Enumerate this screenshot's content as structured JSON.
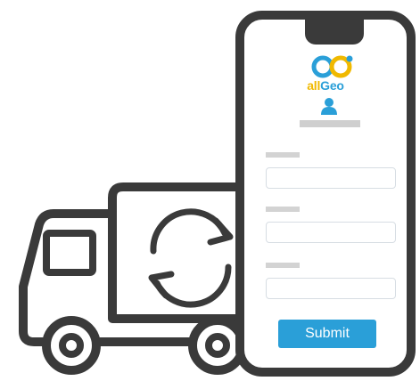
{
  "brand": {
    "logo_prefix": "all",
    "logo_suffix": "Geo",
    "primary_color": "#2a9fd8",
    "accent_color": "#f0b900"
  },
  "form": {
    "submit_label": "Submit",
    "fields": [
      {
        "label": "",
        "value": ""
      },
      {
        "label": "",
        "value": ""
      },
      {
        "label": "",
        "value": ""
      }
    ]
  },
  "illustration": {
    "truck_icon": "delivery-truck-icon",
    "sync_icon": "sync-arrows-icon",
    "stroke_color": "#3a3a3a",
    "device": "smartphone"
  }
}
